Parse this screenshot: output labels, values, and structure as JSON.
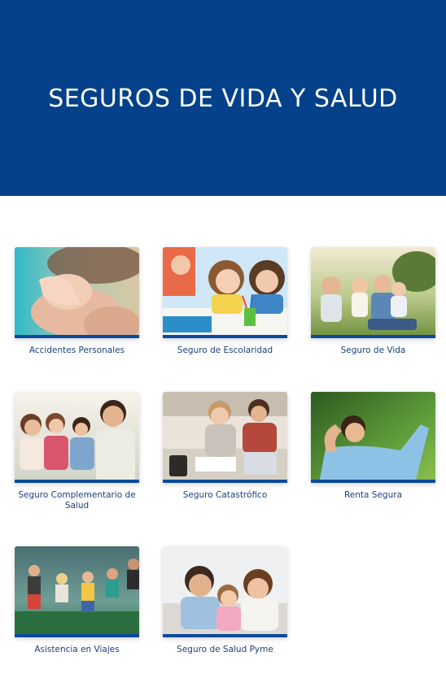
{
  "header": {
    "title": "SEGUROS DE VIDA Y SALUD"
  },
  "theme": {
    "primary": "#04418a",
    "accent_bar": "#0a4a9c",
    "caption_color": "#1b3f7a"
  },
  "products": [
    {
      "label": "Accidentes Personales",
      "image": "hands-photo"
    },
    {
      "label": "Seguro de Escolaridad",
      "image": "children-studying-photo"
    },
    {
      "label": "Seguro de Vida",
      "image": "family-in-park-photo"
    },
    {
      "label": "Seguro Complementario de Salud",
      "image": "family-outdoors-photo"
    },
    {
      "label": "Seguro Catastrófico",
      "image": "couple-paperwork-photo"
    },
    {
      "label": "Renta Segura",
      "image": "relaxed-man-photo"
    },
    {
      "label": "Asistencia en Viajes",
      "image": "people-jumping-photo"
    },
    {
      "label": "Seguro de Salud Pyme",
      "image": "family-portrait-photo"
    }
  ]
}
